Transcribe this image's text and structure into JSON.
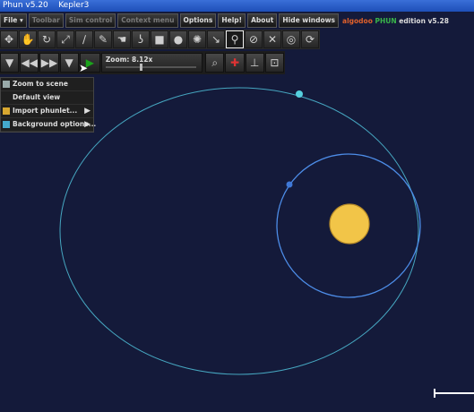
{
  "window": {
    "title": "Phun v5.20    Kepler3"
  },
  "menu": [
    {
      "label": "File ▾",
      "dim": false
    },
    {
      "label": "Toolbar",
      "dim": true
    },
    {
      "label": "Sim control",
      "dim": true
    },
    {
      "label": "Context menu",
      "dim": true
    },
    {
      "label": "Options",
      "dim": false
    },
    {
      "label": "Help!",
      "dim": false
    },
    {
      "label": "About",
      "dim": false
    },
    {
      "label": "Hide windows",
      "dim": false
    }
  ],
  "brand": {
    "part1": "algodoo",
    "part2": "PHUN",
    "part3": "edition v5.28"
  },
  "tools": [
    {
      "name": "move-icon",
      "glyph": "✥"
    },
    {
      "name": "drag-icon",
      "glyph": "✋"
    },
    {
      "name": "rotate-icon",
      "glyph": "↻"
    },
    {
      "name": "scale-icon",
      "glyph": "⤢"
    },
    {
      "name": "knife-icon",
      "glyph": "∕"
    },
    {
      "name": "brush-icon",
      "glyph": "✎"
    },
    {
      "name": "hand-grab-icon",
      "glyph": "☚"
    },
    {
      "name": "chain-icon",
      "glyph": "ʖ"
    },
    {
      "name": "box-icon",
      "glyph": "■"
    },
    {
      "name": "circle-icon",
      "glyph": "●"
    },
    {
      "name": "gear-icon",
      "glyph": "✺"
    },
    {
      "name": "spring-icon",
      "glyph": "↘"
    },
    {
      "name": "fix-icon",
      "glyph": "⚲"
    },
    {
      "name": "hinge-icon",
      "glyph": "⊘"
    },
    {
      "name": "laser-icon",
      "glyph": "✕"
    },
    {
      "name": "thruster-icon",
      "glyph": "◎"
    },
    {
      "name": "tracer-icon",
      "glyph": "⟳"
    }
  ],
  "controls": {
    "zoom_label": "Zoom: 8.12x",
    "zoom_level": 0.38
  },
  "dropdown": [
    {
      "label": "Zoom to scene",
      "icon": "zoom-scene-icon",
      "color": "#9aa",
      "arrow": ""
    },
    {
      "label": "Default view",
      "icon": "",
      "color": "",
      "arrow": ""
    },
    {
      "label": "Import phunlet...",
      "icon": "folder-icon",
      "color": "#d8a830",
      "arrow": "▶"
    },
    {
      "label": "Background options...",
      "icon": "palette-icon",
      "color": "#4ac",
      "arrow": "▶"
    }
  ],
  "colors": {
    "background": "#141a3a",
    "outer_orbit": "#4fc0d8",
    "inner_orbit": "#4d8de8",
    "sun": "#f2c548",
    "outer_planet": "#56d0de",
    "inner_planet": "#3f78d6"
  }
}
